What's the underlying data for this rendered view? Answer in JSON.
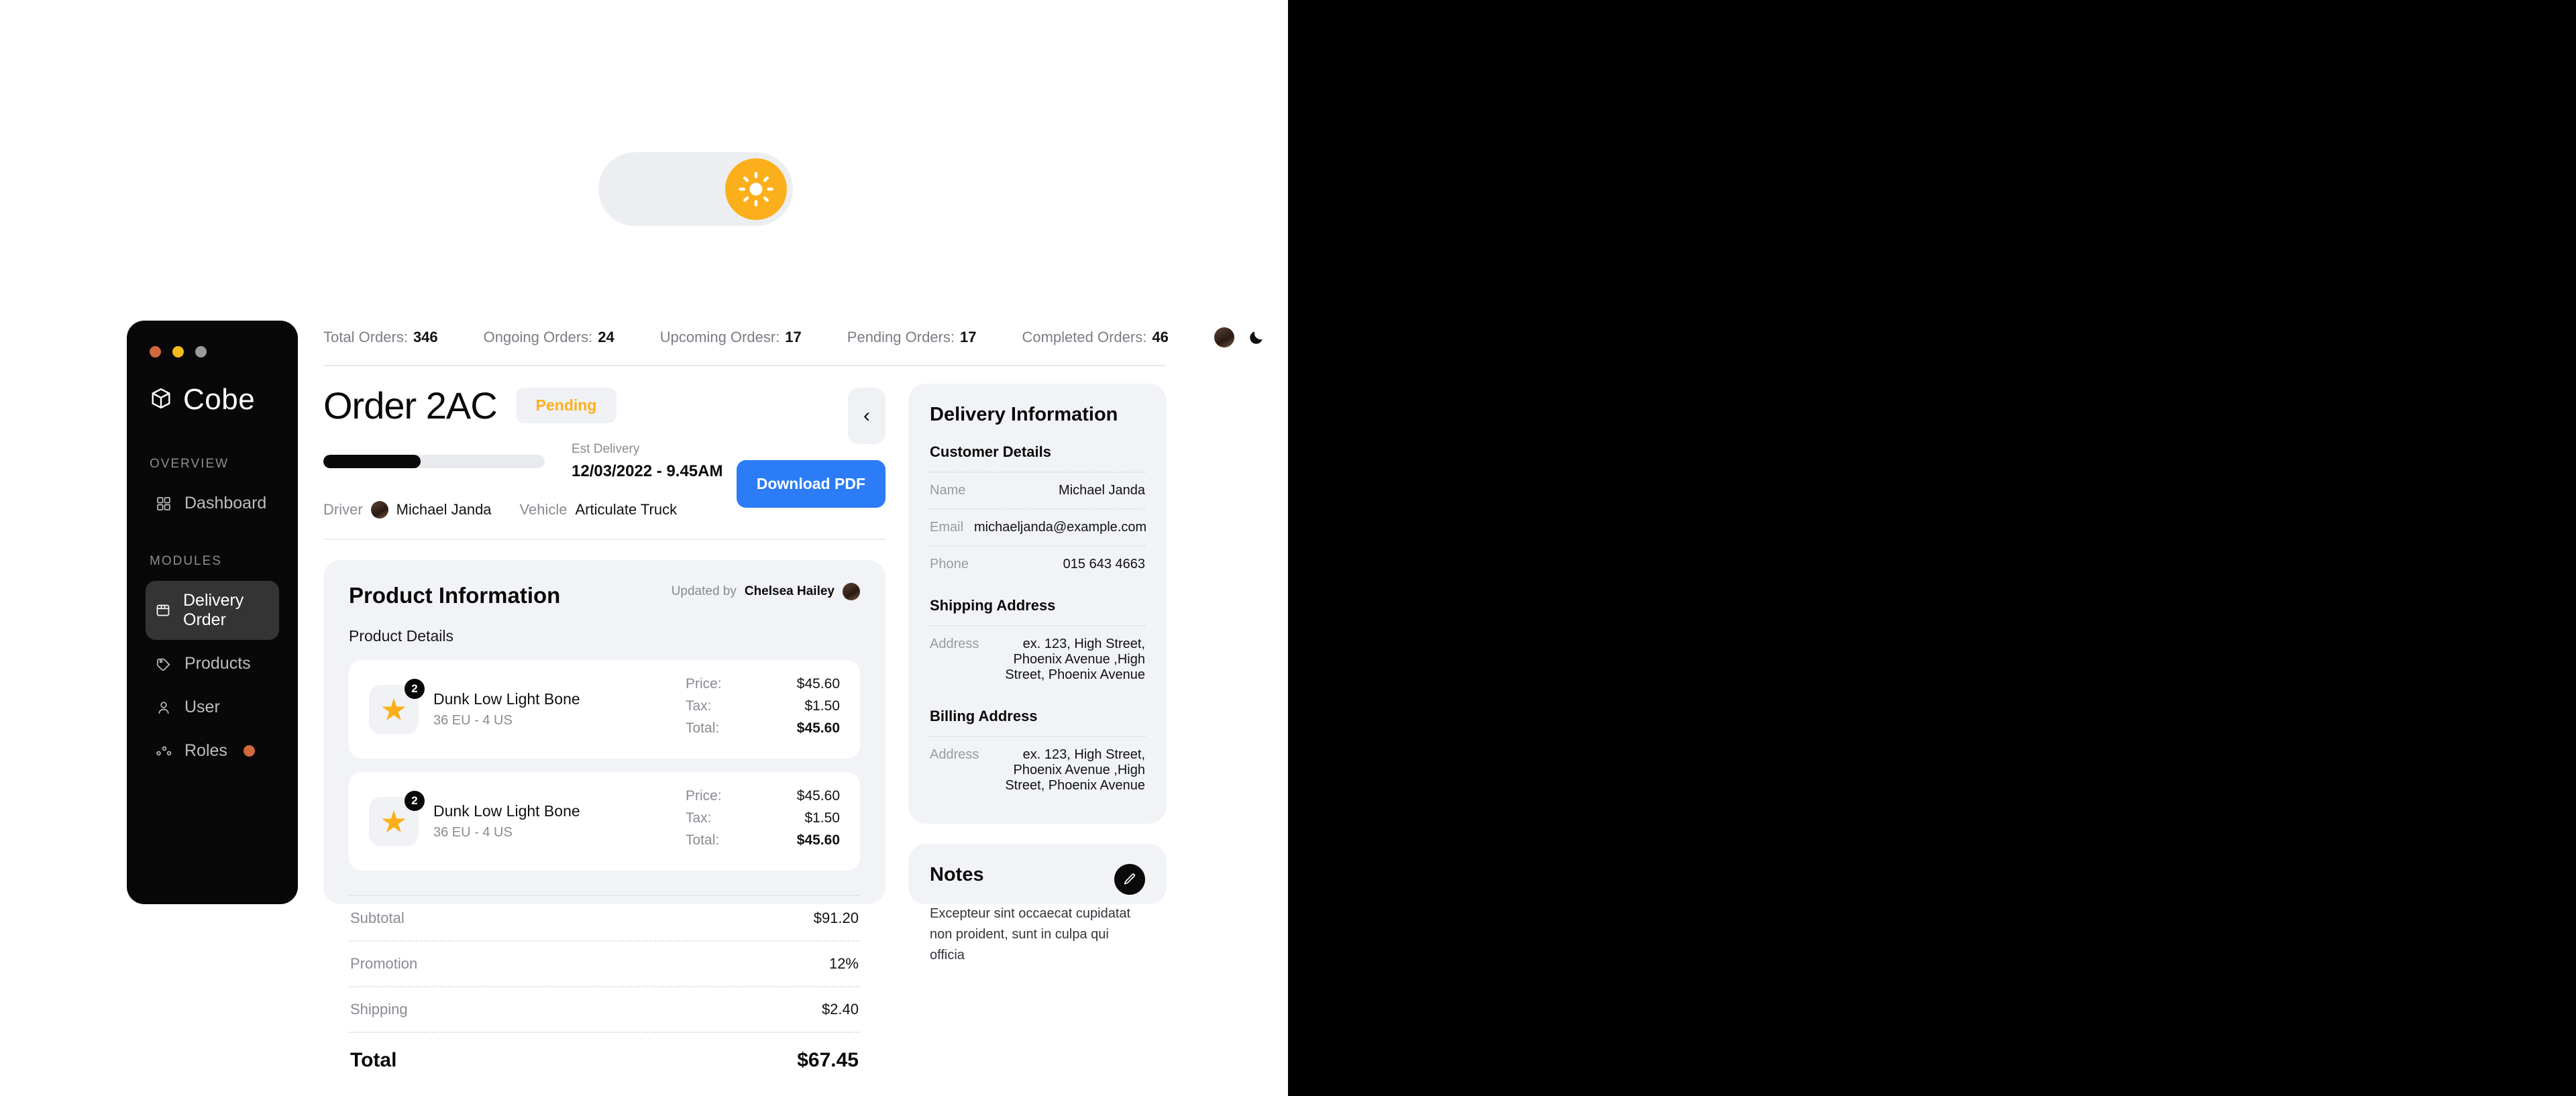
{
  "theme_toggle": {
    "light_icon": "sun-icon",
    "dark_icon": "moon-stars-icon"
  },
  "sidebar": {
    "brand": "Cobe",
    "brand_icon": "cube-icon",
    "sections": [
      {
        "label": "OVERVIEW",
        "items": [
          {
            "label": "Dashboard",
            "icon": "grid-icon",
            "dot": false
          }
        ]
      },
      {
        "label": "MODULES",
        "items": [
          {
            "label": "Delivery Order",
            "icon": "box-icon",
            "dot": false
          },
          {
            "label": "Products",
            "icon": "tag-icon",
            "dot": false
          },
          {
            "label": "User",
            "icon": "user-icon",
            "dot": false
          },
          {
            "label": "Roles",
            "icon": "nodes-icon",
            "dot": true
          }
        ]
      }
    ],
    "active_light": "Delivery Order",
    "active_dark": "Dashboard"
  },
  "stats": [
    {
      "label": "Total Orders:",
      "value": "346"
    },
    {
      "label": "Ongoing Orders:",
      "value": "24"
    },
    {
      "label": "Upcoming Ordesr:",
      "value": "17"
    },
    {
      "label": "Pending Orders:",
      "value": "17"
    },
    {
      "label": "Completed Orders:",
      "value": "46"
    }
  ],
  "order": {
    "title": "Order 2AC",
    "status": "Pending",
    "progress_percent": 44,
    "est_delivery_label": "Est Delivery",
    "est_delivery_value": "12/03/2022 - 9.45AM",
    "download_label": "Download PDF",
    "collapse_icon": "chevron-left-icon",
    "driver_label": "Driver",
    "driver_name": "Michael Janda",
    "vehicle_label": "Vehicle",
    "vehicle_name": "Articulate Truck"
  },
  "product_card": {
    "heading": "Product Information",
    "updated_label": "Updated by",
    "updated_by": "Chelsea Hailey",
    "details_label": "Product Details",
    "price_label": "Price:",
    "tax_label": "Tax:",
    "total_label": "Total:",
    "items": [
      {
        "name": "Dunk Low Light Bone",
        "size": "36 EU - 4 US",
        "qty": "2",
        "price": "$45.60",
        "tax": "$1.50",
        "total": "$45.60",
        "icon": "star-icon"
      },
      {
        "name": "Dunk Low Light Bone",
        "size": "36 EU - 4 US",
        "qty": "2",
        "price": "$45.60",
        "tax": "$1.50",
        "total": "$45.60",
        "icon": "star-icon"
      }
    ]
  },
  "totals": [
    {
      "label": "Subtotal",
      "value": "$91.20"
    },
    {
      "label": "Promotion",
      "value": "12%"
    },
    {
      "label": "Shipping",
      "value": "$2.40"
    }
  ],
  "grand_total": {
    "label": "Total",
    "value": "$67.45"
  },
  "delivery": {
    "heading": "Delivery Information",
    "customer_heading": "Customer Details",
    "customer": [
      {
        "label": "Name",
        "value": "Michael Janda"
      },
      {
        "label": "Email",
        "value": "michaeljanda@example.com"
      },
      {
        "label": "Phone",
        "value": "015 643 4663"
      }
    ],
    "shipping_heading": "Shipping Address",
    "shipping": [
      {
        "label": "Address",
        "value": "ex. 123, High Street, Phoenix Avenue ,High Street, Phoenix Avenue"
      }
    ],
    "billing_heading": "Billing Address",
    "billing": [
      {
        "label": "Address",
        "value": "ex. 123, High Street, Phoenix Avenue ,High Street, Phoenix Avenue"
      }
    ]
  },
  "notes": {
    "heading": "Notes",
    "body": "Excepteur sint occaecat cupidatat non proident, sunt in culpa qui officia",
    "edit_icon": "pencil-icon"
  },
  "colors": {
    "accent_blue": "#2b7cf6",
    "accent_yellow": "#fbb01b",
    "dot_orange": "#d2693e"
  }
}
